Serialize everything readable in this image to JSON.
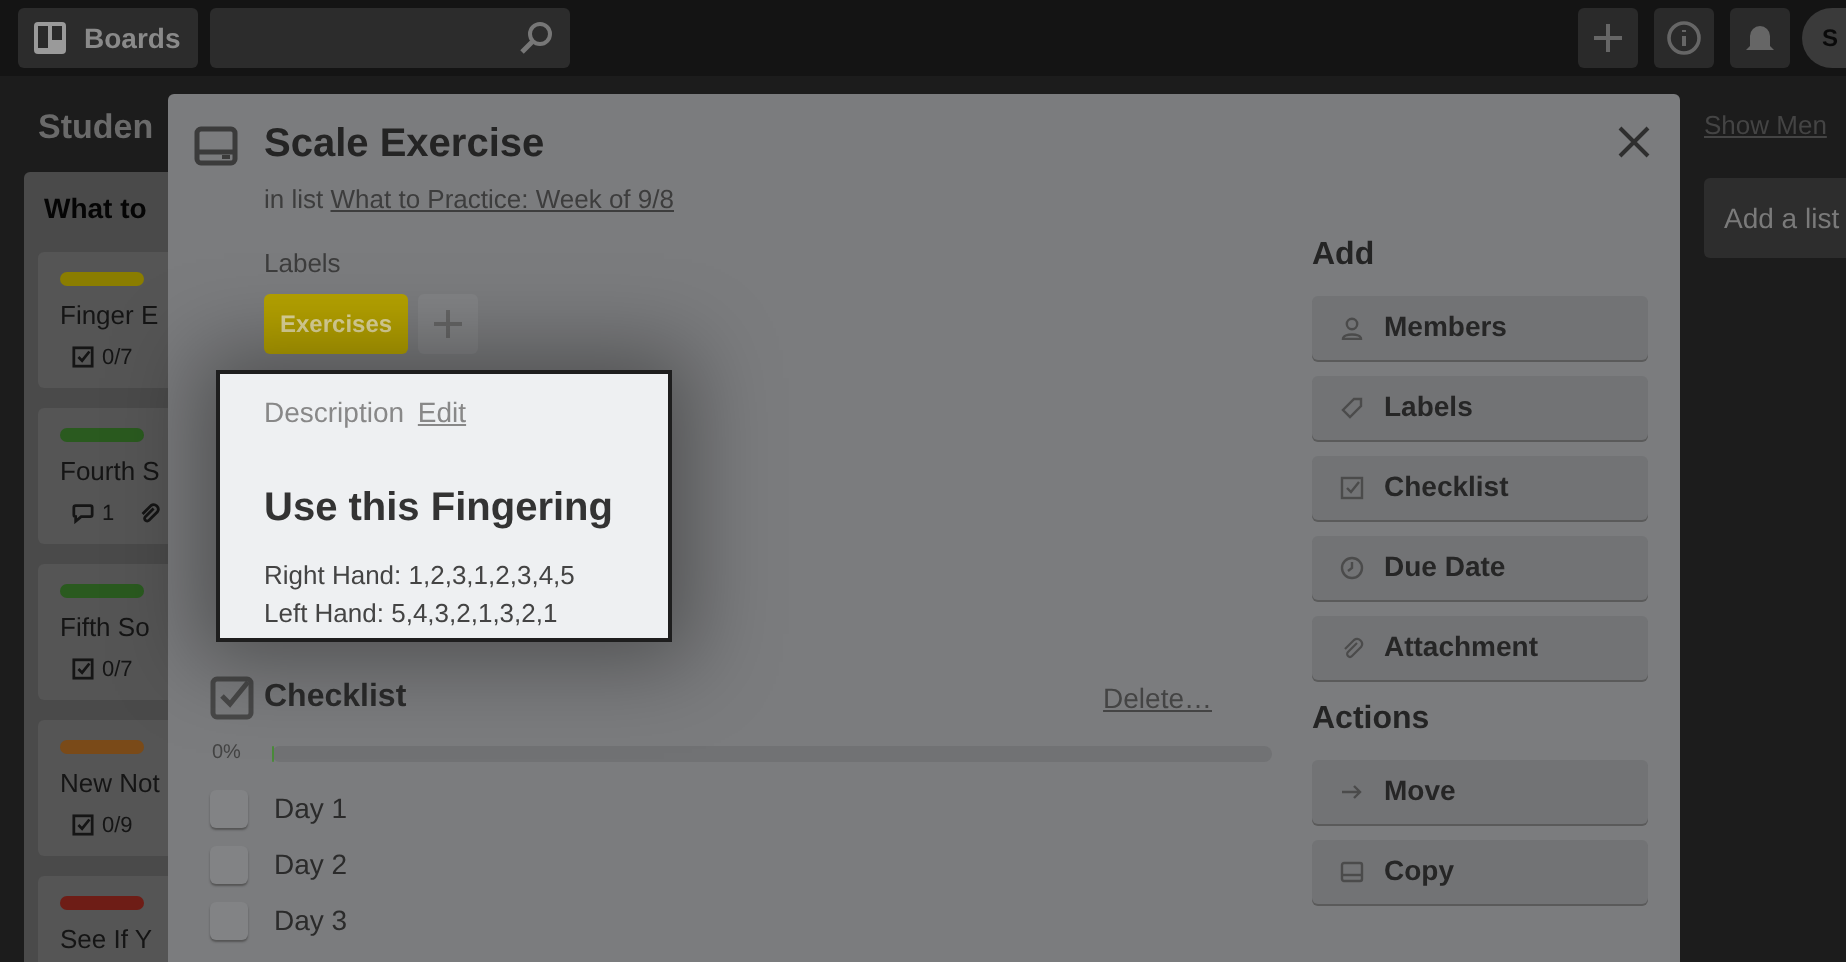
{
  "header": {
    "boards_button": "Boards",
    "avatar": "S"
  },
  "board": {
    "title": "Studen",
    "list_title": "What to",
    "cards": [
      {
        "title": "Finger E",
        "color": "#8a7d00",
        "badges": [
          {
            "kind": "checklist",
            "text": "0/7"
          }
        ]
      },
      {
        "title": "Fourth S",
        "color": "#2a5a1f",
        "badges": [
          {
            "kind": "comment",
            "text": "1"
          },
          {
            "kind": "attachment"
          }
        ]
      },
      {
        "title": "Fifth So",
        "color": "#2a5a1f",
        "badges": [
          {
            "kind": "checklist",
            "text": "0/7"
          }
        ]
      },
      {
        "title": "New Not",
        "color": "#7a4a18",
        "badges": [
          {
            "kind": "checklist",
            "text": "0/9"
          }
        ]
      },
      {
        "title": "See If Y",
        "color": "#6e1d16"
      }
    ],
    "show_menu": "Show Men",
    "add_list": "Add a list"
  },
  "card": {
    "title": "Scale Exercise",
    "in_list_prefix": "in list",
    "list_link": "What to Practice: Week of 9/8",
    "labels_heading": "Labels",
    "labels": [
      {
        "text": "Exercises",
        "color": "#b5a200"
      }
    ],
    "description": {
      "heading": "Description",
      "edit": "Edit",
      "title": "Use this Fingering",
      "lines": [
        "Right Hand: 1,2,3,1,2,3,4,5",
        "Left Hand: 5,4,3,2,1,3,2,1"
      ]
    },
    "checklist": {
      "title": "Checklist",
      "delete": "Delete…",
      "percent": "0%",
      "level": 0,
      "items": [
        {
          "text": "Day 1",
          "checked": false
        },
        {
          "text": "Day 2",
          "checked": false
        },
        {
          "text": "Day 3",
          "checked": false
        }
      ]
    },
    "add_heading": "Add",
    "add_buttons": [
      {
        "kind": "members",
        "label": "Members"
      },
      {
        "kind": "labels",
        "label": "Labels"
      },
      {
        "kind": "checklist",
        "label": "Checklist"
      },
      {
        "kind": "due",
        "label": "Due Date"
      },
      {
        "kind": "attachment",
        "label": "Attachment"
      }
    ],
    "actions_heading": "Actions",
    "action_buttons": [
      {
        "kind": "move",
        "label": "Move"
      },
      {
        "kind": "copy",
        "label": "Copy"
      }
    ]
  }
}
